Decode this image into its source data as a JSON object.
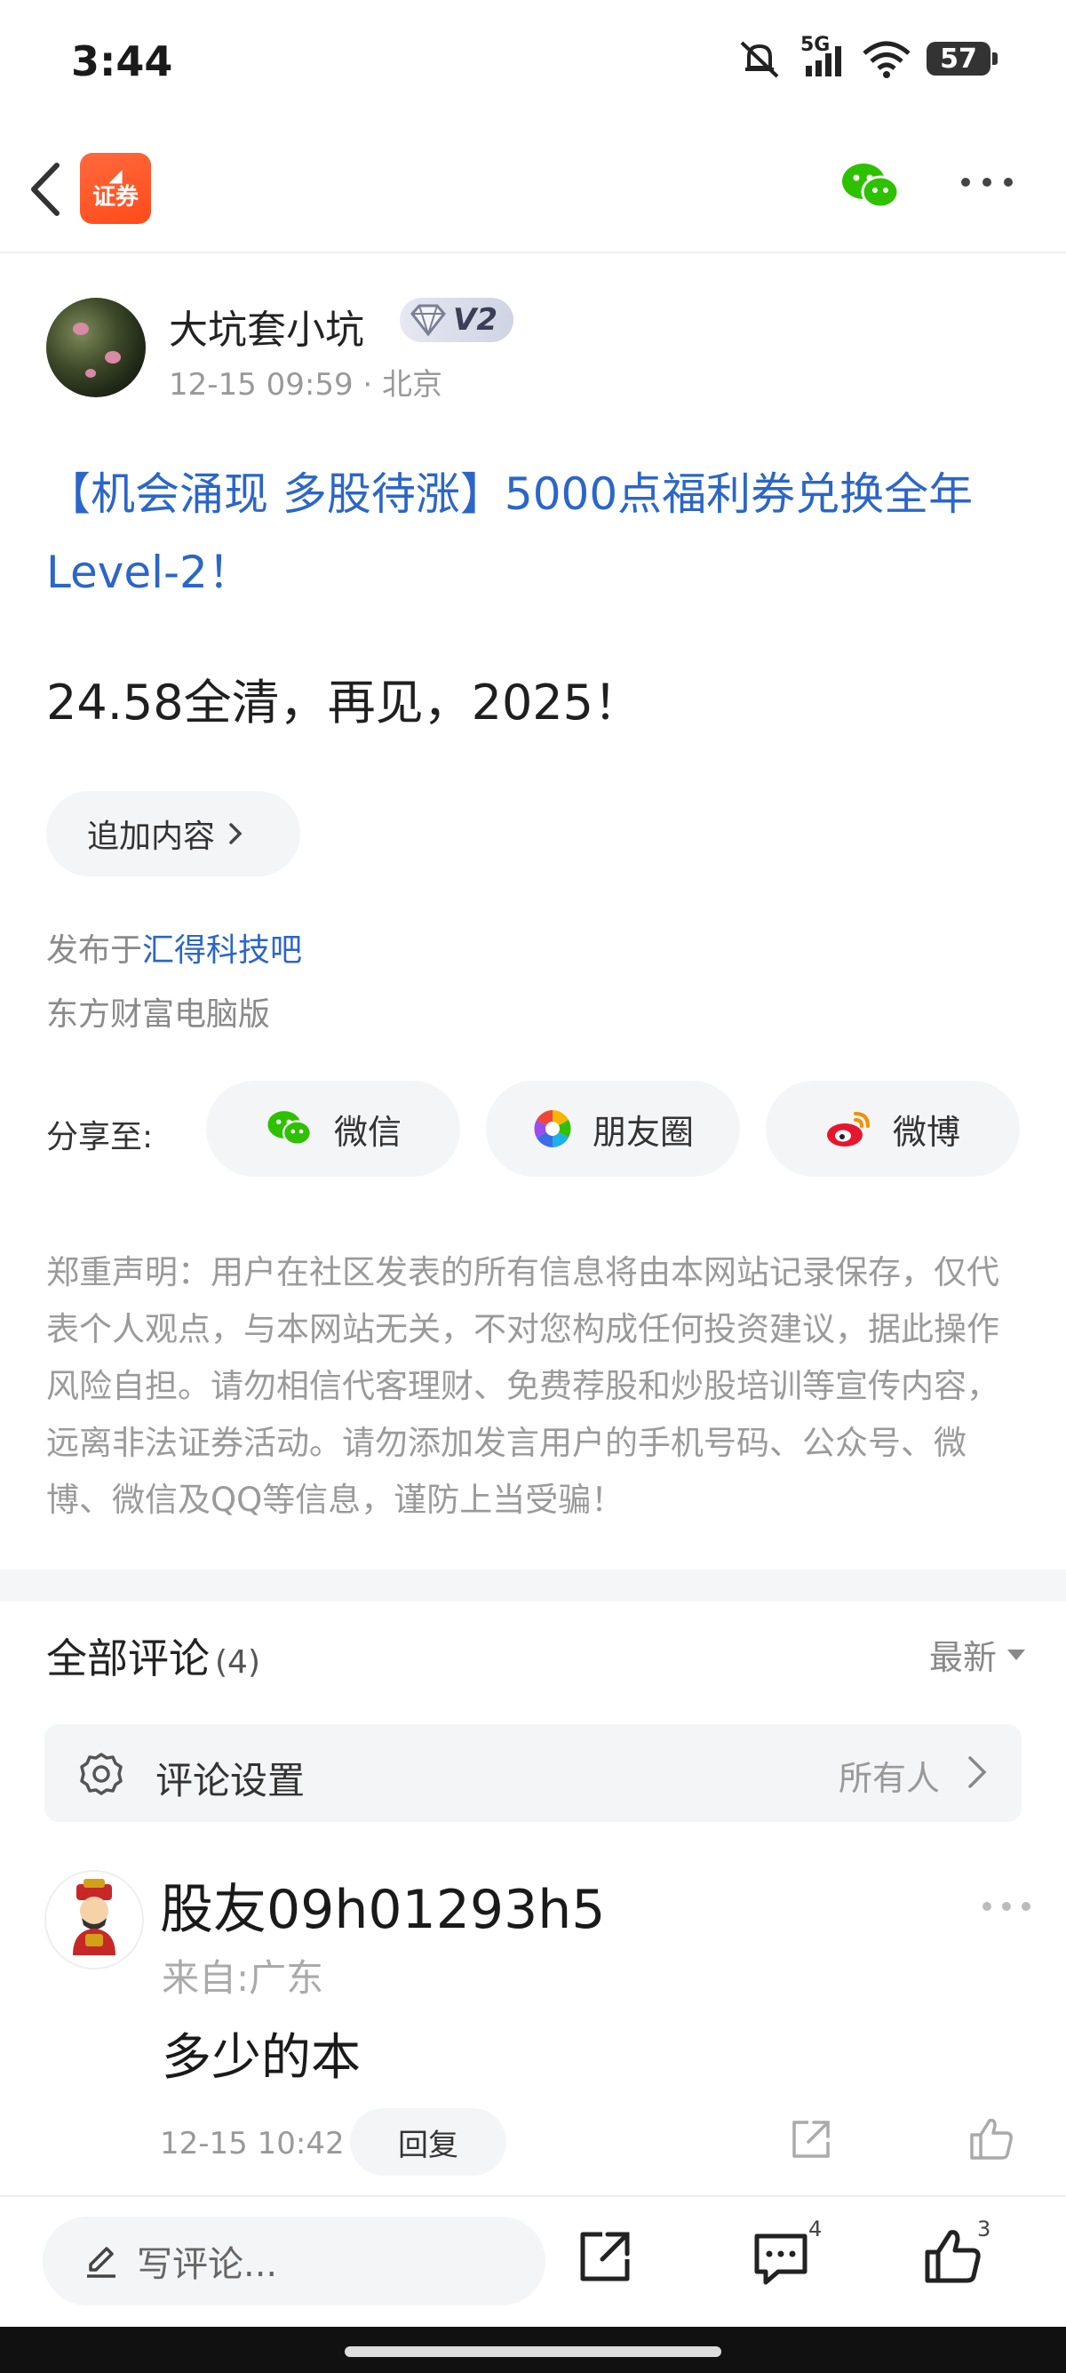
{
  "status_bar": {
    "time": "3:44",
    "network": "5G",
    "battery": "57"
  },
  "nav": {
    "app_logo_text": "证券"
  },
  "author": {
    "name": "大坑套小坑",
    "level": "V2",
    "meta": "12-15 09:59 · 北京"
  },
  "post": {
    "title": "【机会涌现 多股待涨】5000点福利券兑换全年Level-2！",
    "body": "24.58全清，再见，2025！",
    "append_label": "追加内容",
    "published_prefix": "发布于",
    "forum": "汇得科技吧",
    "client": "东方财富电脑版"
  },
  "share": {
    "label": "分享至:",
    "wechat": "微信",
    "moments": "朋友圈",
    "weibo": "微博"
  },
  "disclaimer": "郑重声明：用户在社区发表的所有信息将由本网站记录保存，仅代表个人观点，与本网站无关，不对您构成任何投资建议，据此操作风险自担。请勿相信代客理财、免费荐股和炒股培训等宣传内容，远离非法证券活动。请勿添加发言用户的手机号码、公众号、微博、微信及QQ等信息，谨防上当受骗！",
  "comments": {
    "title": "全部评论",
    "count": "(4)",
    "sort": "最新",
    "settings_label": "评论设置",
    "settings_value": "所有人",
    "items": [
      {
        "name": "股友09h01293h5",
        "from": "来自:广东",
        "text": "多少的本",
        "time": "12-15 10:42",
        "reply_label": "回复"
      }
    ]
  },
  "bottom_bar": {
    "write_placeholder": "写评论...",
    "comment_count": "4",
    "like_count": "3"
  },
  "colors": {
    "link_blue": "#2b66c8",
    "brand_orange": "#ff5a26",
    "wechat_green": "#2dc100"
  }
}
